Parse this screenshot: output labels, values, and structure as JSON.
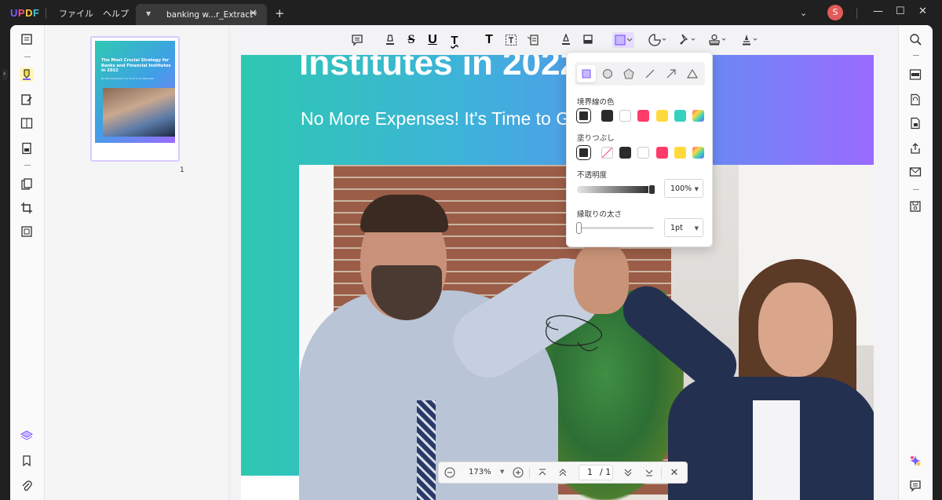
{
  "app": {
    "brand": [
      "U",
      "P",
      "D",
      "F"
    ],
    "menu": [
      "ファイル",
      "ヘルプ"
    ],
    "tab_title": "banking w...r_Extract*",
    "avatar_initial": "S"
  },
  "thumbnail": {
    "title": "The Most Crucial Strategy for Banks and Financial Institutes in 2022",
    "subtitle": "No More Expenses! It's Time to Go Paperless",
    "page_number": "1"
  },
  "document": {
    "heading": "Institutes in 2022",
    "subheading": "No More Expenses! It's Time to Go Paperless"
  },
  "shape_popover": {
    "shapes": [
      "rectangle",
      "ellipse",
      "polygon",
      "line",
      "arrow",
      "triangle"
    ],
    "selected_shape": "rectangle",
    "border_color_label": "境界線の色",
    "border_colors": [
      "#2b2b2b",
      "#2b2b2b",
      "#ffffff",
      "#ff3b6b",
      "#ffd93b",
      "#34d1bf",
      "rainbow"
    ],
    "fill_label": "塗りつぶし",
    "fill_colors": [
      "#2b2b2b",
      "none",
      "#2b2b2b",
      "#ffffff",
      "#ff3b6b",
      "#ffd93b",
      "rainbow"
    ],
    "opacity_label": "不透明度",
    "opacity_value": "100%",
    "stroke_label": "縁取りの太さ",
    "stroke_value": "1pt"
  },
  "pager": {
    "zoom": "173%",
    "current_page": "1",
    "total_pages": "/ 1"
  },
  "colors": {
    "accent": "#7c5cff",
    "selected_shape_bg": "#e7ddff"
  }
}
